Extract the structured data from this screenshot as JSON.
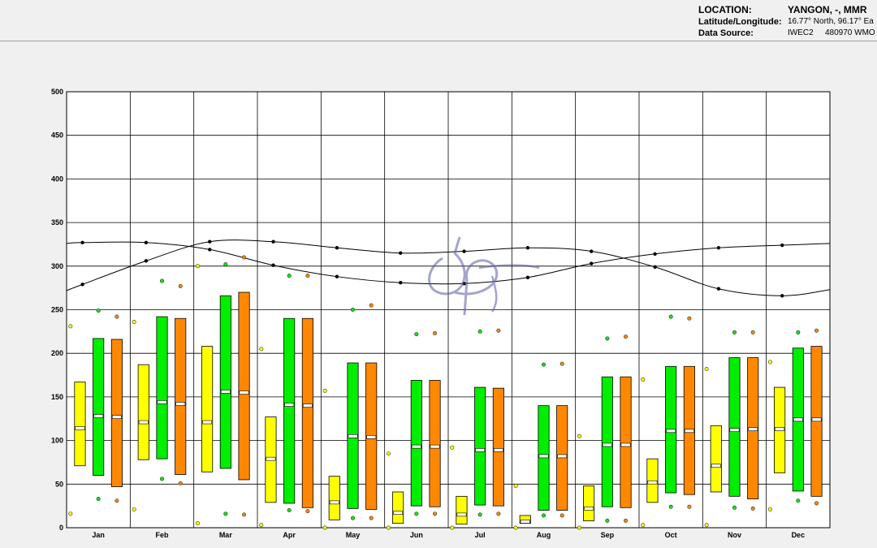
{
  "info": {
    "location_label": "LOCATION:",
    "location_value": "YANGON, -, MMR",
    "latlon_label": "Latitude/Longitude:",
    "latlon_value": "16.77° North, 96.17° Ea",
    "source_label": "Data Source:",
    "source_value": "IWEC2",
    "source_value2": "480970 WMO"
  },
  "chart_data": {
    "type": "box",
    "categories": [
      "Jan",
      "Feb",
      "Mar",
      "Apr",
      "May",
      "Jun",
      "Jul",
      "Aug",
      "Sep",
      "Oct",
      "Nov",
      "Dec"
    ],
    "ylim": [
      0,
      500
    ],
    "yticks": [
      0,
      50,
      100,
      150,
      200,
      250,
      300,
      350,
      400,
      450,
      500
    ],
    "grid": true,
    "series": [
      {
        "color": "#ffff00",
        "low": [
          71,
          78,
          64,
          29,
          9,
          5,
          4,
          5,
          8,
          29,
          41,
          63
        ],
        "high": [
          167,
          187,
          208,
          127,
          59,
          41,
          36,
          14,
          48,
          79,
          117,
          161
        ],
        "mean": [
          114,
          121,
          121,
          79,
          29,
          17,
          15,
          7,
          22,
          52,
          71,
          113
        ],
        "dot_high": [
          231,
          236,
          300,
          205,
          157,
          85,
          92,
          48,
          105,
          170,
          182,
          190
        ],
        "dot_low": [
          16,
          21,
          5,
          3,
          0,
          0,
          0,
          0,
          0,
          3,
          3,
          21
        ]
      },
      {
        "color": "#00ee00",
        "low": [
          60,
          79,
          68,
          28,
          22,
          25,
          26,
          20,
          24,
          40,
          36,
          42
        ],
        "high": [
          217,
          242,
          266,
          240,
          189,
          169,
          161,
          140,
          173,
          185,
          195,
          206
        ],
        "mean": [
          128,
          144,
          156,
          141,
          105,
          93,
          89,
          82,
          95,
          111,
          112,
          124
        ],
        "dot_high": [
          249,
          283,
          302,
          289,
          250,
          222,
          225,
          187,
          217,
          242,
          224,
          224
        ],
        "dot_low": [
          33,
          56,
          16,
          20,
          11,
          16,
          15,
          14,
          8,
          24,
          23,
          31
        ]
      },
      {
        "color": "#ff8800",
        "low": [
          47,
          61,
          55,
          23,
          21,
          24,
          25,
          20,
          23,
          38,
          33,
          36
        ],
        "high": [
          216,
          240,
          270,
          240,
          189,
          169,
          160,
          140,
          173,
          185,
          195,
          208
        ],
        "mean": [
          127,
          142,
          155,
          140,
          104,
          93,
          89,
          82,
          95,
          111,
          113,
          124
        ],
        "dot_high": [
          242,
          277,
          310,
          289,
          255,
          223,
          226,
          188,
          219,
          240,
          224,
          226
        ],
        "dot_low": [
          31,
          51,
          15,
          19,
          11,
          16,
          16,
          14,
          8,
          24,
          22,
          28
        ]
      }
    ],
    "curves": [
      {
        "name": "",
        "values": [
          279,
          306,
          328,
          328,
          321,
          315,
          317,
          321,
          317,
          299,
          274,
          266
        ],
        "start": 272,
        "end": 273
      },
      {
        "name": "",
        "values": [
          327,
          327,
          319,
          301,
          288,
          281,
          280,
          287,
          303,
          314,
          321,
          324
        ],
        "start": 326,
        "end": 326
      }
    ]
  }
}
